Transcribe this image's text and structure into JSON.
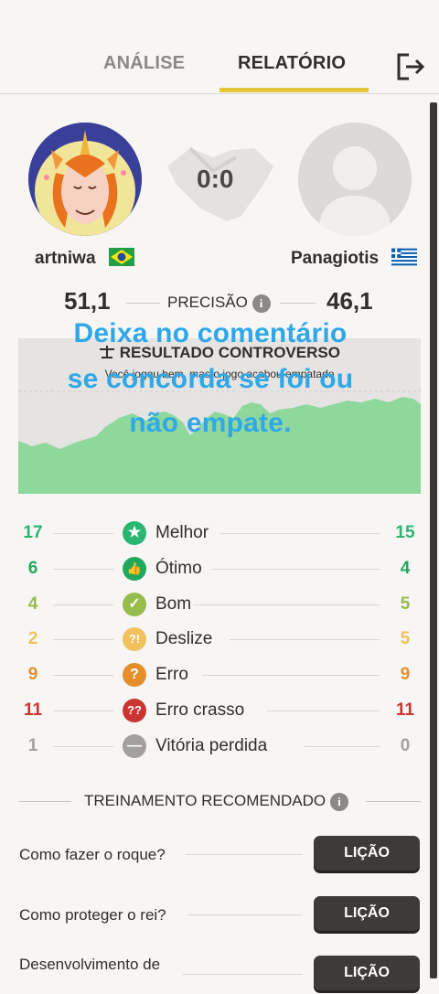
{
  "tabs": [
    {
      "label": "ANÁLISE",
      "active": false
    },
    {
      "label": "RELATÓRIO",
      "active": true
    }
  ],
  "players": {
    "white": {
      "name": "artniwa",
      "flag": "brazil",
      "accuracy": "51,1"
    },
    "black": {
      "name": "Panagiotis",
      "flag": "greece",
      "accuracy": "46,1"
    }
  },
  "score": "0:0",
  "accuracy_label": "PRECISÃO",
  "result": {
    "title": "RESULTADO CONTROVERSO",
    "subtitle": "Você jogou bem, mas o jogo acabou empatado"
  },
  "overlay_text": [
    "Deixa no comentário",
    "se concorda se foi ou",
    "não empate."
  ],
  "move_stats": [
    {
      "label": "Melhor",
      "white": "17",
      "black": "15",
      "icon": "star-icon",
      "color": "#29b672"
    },
    {
      "label": "Ótimo",
      "white": "6",
      "black": "4",
      "icon": "thumbs-up-icon",
      "color": "#22a85e"
    },
    {
      "label": "Bom",
      "white": "4",
      "black": "5",
      "icon": "check-icon",
      "color": "#96bc4b"
    },
    {
      "label": "Deslize",
      "white": "2",
      "black": "5",
      "icon": "inaccuracy-icon",
      "color": "#f0c15c"
    },
    {
      "label": "Erro",
      "white": "9",
      "black": "9",
      "icon": "question-icon",
      "color": "#e58f2a"
    },
    {
      "label": "Erro crasso",
      "white": "11",
      "black": "11",
      "icon": "double-question-icon",
      "color": "#ca3431"
    },
    {
      "label": "Vitória perdida",
      "white": "1",
      "black": "0",
      "icon": "minus-icon",
      "color": "#a3a19f"
    }
  ],
  "training": {
    "title": "TREINAMENTO RECOMENDADO",
    "lessons": [
      {
        "text": "Como fazer o roque?",
        "button": "LIÇÃO"
      },
      {
        "text": "Como proteger o rei?",
        "button": "LIÇÃO"
      },
      {
        "text": "Desenvolvimento de",
        "button": "LIÇÃO"
      }
    ]
  }
}
